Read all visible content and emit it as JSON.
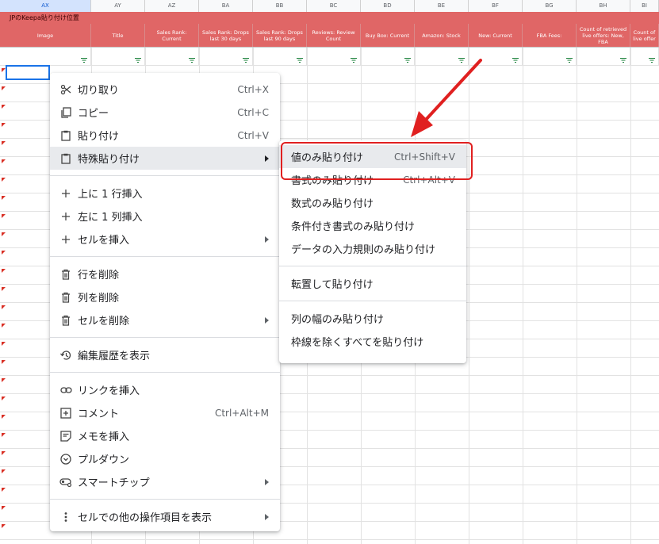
{
  "sheet": {
    "column_letters": [
      "AX",
      "AY",
      "AZ",
      "BA",
      "BB",
      "BC",
      "BD",
      "BE",
      "BF",
      "BG",
      "BH",
      "BI"
    ],
    "selected_column": "AX",
    "title_cell": "JPのKeepa貼り付け位置",
    "header_cells": [
      "Image",
      "Title",
      "Sales Rank: Current",
      "Sales Rank: Drops last 30 days",
      "Sales Rank: Drops last 90 days",
      "Reviews: Review Count",
      "Buy Box: Current",
      "Amazon: Stock",
      "New: Current",
      "FBA Fees:",
      "Count of retrieved live offers: New, FBA",
      "Count of live offer"
    ],
    "colors": {
      "header_bg": "#e06666",
      "selection": "#1a73e8",
      "filter_icon": "#188038",
      "annotation": "#e02020"
    }
  },
  "context_menu": {
    "items": [
      {
        "icon": "scissors-icon",
        "label": "切り取り",
        "shortcut": "Ctrl+X"
      },
      {
        "icon": "copy-icon",
        "label": "コピー",
        "shortcut": "Ctrl+C"
      },
      {
        "icon": "clipboard-icon",
        "label": "貼り付け",
        "shortcut": "Ctrl+V"
      },
      {
        "icon": "clipboard-icon",
        "label": "特殊貼り付け",
        "shortcut": ""
      },
      {
        "icon": "plus-icon",
        "label": "上に 1 行挿入",
        "shortcut": ""
      },
      {
        "icon": "plus-icon",
        "label": "左に 1 列挿入",
        "shortcut": ""
      },
      {
        "icon": "plus-icon",
        "label": "セルを挿入",
        "shortcut": ""
      },
      {
        "icon": "trash-icon",
        "label": "行を削除",
        "shortcut": ""
      },
      {
        "icon": "trash-icon",
        "label": "列を削除",
        "shortcut": ""
      },
      {
        "icon": "trash-icon",
        "label": "セルを削除",
        "shortcut": ""
      },
      {
        "icon": "history-icon",
        "label": "編集履歴を表示",
        "shortcut": ""
      },
      {
        "icon": "link-icon",
        "label": "リンクを挿入",
        "shortcut": ""
      },
      {
        "icon": "comment-icon",
        "label": "コメント",
        "shortcut": "Ctrl+Alt+M"
      },
      {
        "icon": "note-icon",
        "label": "メモを挿入",
        "shortcut": ""
      },
      {
        "icon": "dropdown-icon",
        "label": "プルダウン",
        "shortcut": ""
      },
      {
        "icon": "smart-chip-icon",
        "label": "スマートチップ",
        "shortcut": ""
      },
      {
        "icon": "more-vert-icon",
        "label": "セルでの他の操作項目を表示",
        "shortcut": ""
      }
    ]
  },
  "paste_special_menu": {
    "items": [
      {
        "label": "値のみ貼り付け",
        "shortcut": "Ctrl+Shift+V"
      },
      {
        "label": "書式のみ貼り付け",
        "shortcut": "Ctrl+Alt+V"
      },
      {
        "label": "数式のみ貼り付け",
        "shortcut": ""
      },
      {
        "label": "条件付き書式のみ貼り付け",
        "shortcut": ""
      },
      {
        "label": "データの入力規則のみ貼り付け",
        "shortcut": ""
      },
      {
        "label": "転置して貼り付け",
        "shortcut": ""
      },
      {
        "label": "列の幅のみ貼り付け",
        "shortcut": ""
      },
      {
        "label": "枠線を除くすべてを貼り付け",
        "shortcut": ""
      }
    ]
  }
}
